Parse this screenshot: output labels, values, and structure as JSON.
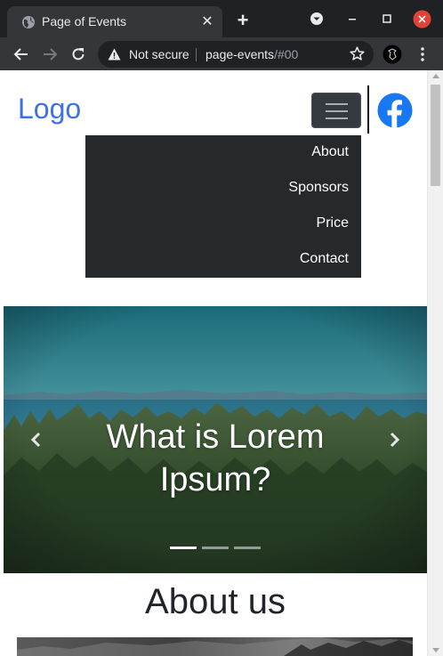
{
  "browser": {
    "tab_title": "Page of Events",
    "security_label": "Not secure",
    "url_host": "page-events",
    "url_path": "/#00"
  },
  "site": {
    "logo_text": "Logo",
    "nav_items": [
      {
        "label": "About"
      },
      {
        "label": "Sponsors"
      },
      {
        "label": "Price"
      },
      {
        "label": "Contact"
      }
    ],
    "social_icon": "facebook-icon"
  },
  "carousel": {
    "caption": "What is Lorem Ipsum?",
    "slide_count": 3,
    "active_slide": 1
  },
  "sections": {
    "about_title": "About us"
  },
  "colors": {
    "logo": "#3b72e6",
    "navbar_toggle_bg": "#343a40",
    "dropdown_bg": "#26292b",
    "facebook_blue": "#1877f2",
    "chrome_dark": "#202124",
    "chrome_mid": "#35363a"
  }
}
